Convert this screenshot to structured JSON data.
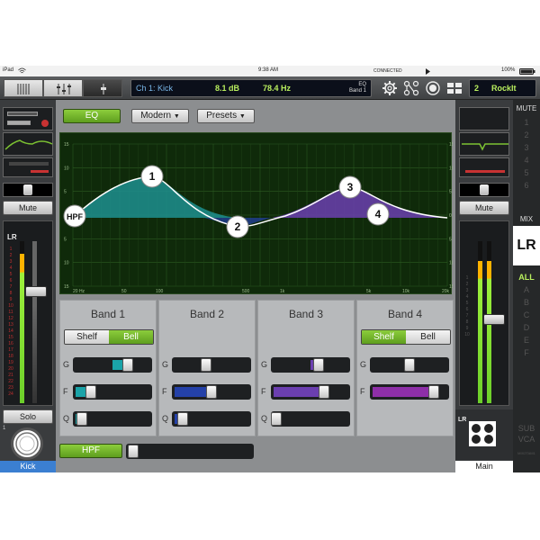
{
  "status_bar": {
    "device": "iPad",
    "time": "9:38 AM",
    "connection": "CONNECTED",
    "battery": "100%"
  },
  "toolbar": {
    "channel_name": "Ch 1: Kick",
    "gain_value": "8.1 dB",
    "freq_value": "78.4 Hz",
    "section_line1": "EQ",
    "section_line2": "Band 1",
    "snapshot_number": "2",
    "snapshot_name": "RockIt"
  },
  "left_strip": {
    "mute_label": "Mute",
    "meter_label": "LR",
    "solo_label": "Solo",
    "channel_number": "1",
    "channel_label": "Kick",
    "fader_level": 0.72,
    "meter_level": 0.92
  },
  "main": {
    "eq_button": "EQ",
    "mode_dropdown": "Modern",
    "presets_dropdown": "Presets",
    "hpf_button": "HPF"
  },
  "eq_graph": {
    "y_ticks_left": [
      "15",
      "10",
      "5",
      "0",
      "5",
      "10",
      "15"
    ],
    "y_ticks_right": [
      "15",
      "10",
      "5",
      "0",
      "5",
      "10",
      "15"
    ],
    "x_ticks": [
      "20 Hz",
      "50",
      "100",
      "500",
      "1k",
      "5k",
      "10k",
      "20k"
    ],
    "node_labels": [
      "HPF",
      "1",
      "2",
      "3",
      "4"
    ]
  },
  "bands": [
    {
      "title": "Band 1",
      "toggle": [
        "Shelf",
        "Bell"
      ],
      "active": 1,
      "params": [
        "G",
        "F",
        "Q"
      ],
      "values": [
        0.72,
        0.18,
        0.05
      ],
      "color": "#1aa3a8"
    },
    {
      "title": "Band 2",
      "toggle": [],
      "active": -1,
      "params": [
        "G",
        "F",
        "Q"
      ],
      "values": [
        0.42,
        0.5,
        0.08
      ],
      "color": "#2441a8"
    },
    {
      "title": "Band 3",
      "toggle": [],
      "active": -1,
      "params": [
        "G",
        "F",
        "Q"
      ],
      "values": [
        0.62,
        0.7,
        0.0
      ],
      "color": "#6b3fb0"
    },
    {
      "title": "Band 4",
      "toggle": [
        "Shelf",
        "Bell"
      ],
      "active": 0,
      "params": [
        "G",
        "F"
      ],
      "values": [
        0.5,
        0.86
      ],
      "color": "#8e2fa8"
    }
  ],
  "right_strip": {
    "mute_header": "MUTE",
    "mute_label": "Mute",
    "mute_groups": [
      "1",
      "2",
      "3",
      "4",
      "5",
      "6"
    ],
    "mix_header": "MIX",
    "mix_selected": "LR",
    "mix_items": [
      "ALL",
      "A",
      "B",
      "C",
      "D",
      "E",
      "F"
    ],
    "sub_label": "SUB",
    "vca_label": "VCA",
    "mixer_name": "MIX2TAM1",
    "lr_tag": "LR",
    "main_label": "Main",
    "fader_level": 0.55
  },
  "colors": {
    "accent_green": "#7cc232",
    "eq_bg": "#0f2a0a",
    "meter_green": "#9df03b"
  },
  "icons": [
    "wifi-icon",
    "battery-icon",
    "play-icon",
    "gear-icon",
    "routing-icon",
    "record-icon",
    "layout-icon"
  ]
}
